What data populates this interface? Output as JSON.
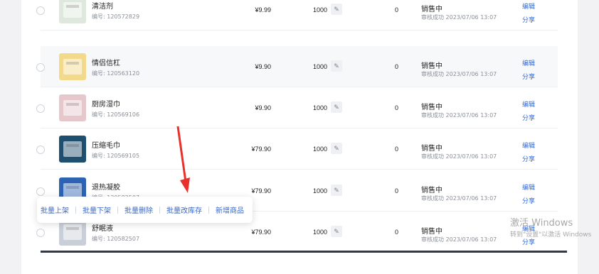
{
  "products": [
    {
      "name": "清洁剂",
      "code": "编号: 120572829",
      "price": "¥9.99",
      "stock": "1000",
      "sales": "0",
      "status": "销售中",
      "audit": "审核成功 2023/07/06 13:07",
      "shaded": false,
      "thumb_color": "#dfe8dc"
    },
    {
      "name": "情侣信杠",
      "code": "编号: 120563120",
      "price": "¥9.90",
      "stock": "1000",
      "sales": "0",
      "status": "销售中",
      "audit": "审核成功 2023/07/06 13:07",
      "shaded": true,
      "thumb_color": "#f3d98a"
    },
    {
      "name": "厨房湿巾",
      "code": "编号: 120569106",
      "price": "¥9.90",
      "stock": "1000",
      "sales": "0",
      "status": "销售中",
      "audit": "审核成功 2023/07/06 13:07",
      "shaded": false,
      "thumb_color": "#e6c7cc"
    },
    {
      "name": "压缩毛巾",
      "code": "编号: 120569105",
      "price": "¥79.90",
      "stock": "1000",
      "sales": "0",
      "status": "销售中",
      "audit": "审核成功 2023/07/06 13:07",
      "shaded": false,
      "thumb_color": "#1f4f6e"
    },
    {
      "name": "退热凝胶",
      "code": "编号: 120582507",
      "price": "¥79.90",
      "stock": "1000",
      "sales": "0",
      "status": "销售中",
      "audit": "审核成功 2023/07/06 13:07",
      "shaded": false,
      "thumb_color": "#2c63b3"
    },
    {
      "name": "舒眠液",
      "code": "编号: 120582507",
      "price": "¥79.90",
      "stock": "1000",
      "sales": "0",
      "status": "销售中",
      "audit": "审核成功 2023/07/06 13:07",
      "shaded": false,
      "thumb_color": "#c9cfd8"
    }
  ],
  "row_actions": {
    "edit": "编辑",
    "share": "分享",
    "stock_edit_icon": "pencil-icon"
  },
  "batch_actions": [
    "批量上架",
    "批量下架",
    "批量删除",
    "批量改库存",
    "新增商品"
  ],
  "watermark": {
    "line1": "激活 Windows",
    "line2": "转到\"设置\"以激活 Windows"
  },
  "colors": {
    "link": "#2f6ad8",
    "arrow": "#e8312a",
    "accent_bar": "#2d3a4d"
  }
}
